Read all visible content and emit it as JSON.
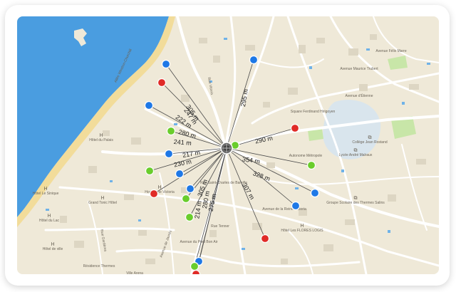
{
  "map": {
    "places": [
      {
        "label": "Allée Winston-Churchill",
        "icon": null
      },
      {
        "label": "Allée Winston-Churchill",
        "icon": null
      },
      {
        "label": "Avenue Maurice Trubert",
        "icon": null
      },
      {
        "label": "Avenue Félix Marre",
        "icon": null
      },
      {
        "label": "Avenue d'Étienne",
        "icon": null
      },
      {
        "label": "Hôtel du Palais",
        "icon": "H"
      },
      {
        "label": "Square Ferdinand Hirigoyen",
        "icon": null
      },
      {
        "label": "Collège Jean Rostand",
        "icon": "school"
      },
      {
        "label": "Lycée André Malraux",
        "icon": "school"
      },
      {
        "label": "Autonome Métropole",
        "icon": null
      },
      {
        "label": "Rue Vitoria",
        "icon": null
      },
      {
        "label": "Grand Tonic Hôtel",
        "icon": "H"
      },
      {
        "label": "Hostellerie Victoria",
        "icon": "H"
      },
      {
        "label": "Groupe Scolaire des Thermes Salins",
        "icon": "school"
      },
      {
        "label": "Hôtel du Lac",
        "icon": "H"
      },
      {
        "label": "Hôtel de ville",
        "icon": "H"
      },
      {
        "label": "Résidence Thermes",
        "icon": null
      },
      {
        "label": "Avenue du Pont Bon Air",
        "icon": null
      },
      {
        "label": "Rue Tenner",
        "icon": null
      },
      {
        "label": "Hôtel Les FLORES LOGIS",
        "icon": "H"
      },
      {
        "label": "Ville Arena",
        "icon": null
      },
      {
        "label": "Rue Saint-Charles de Bareille",
        "icon": null
      },
      {
        "label": "Avenue de la Reine Victoria",
        "icon": null
      },
      {
        "label": "Hôtel Le Sinique",
        "icon": "H"
      },
      {
        "label": "Rue Gardères",
        "icon": null
      },
      {
        "label": "Avenue de Jaurès",
        "icon": null
      }
    ],
    "distances": [
      "305 m",
      "222 m",
      "247 m",
      "280 m",
      "241 m",
      "217 m",
      "230 m",
      "295 m",
      "290 m",
      "354 m",
      "328 m",
      "307 m",
      "305 m",
      "280 m",
      "275 m",
      "214 m"
    ],
    "markers": [
      {
        "status": "available",
        "color": "#1e78e6"
      },
      {
        "status": "taken",
        "color": "#e02b27"
      },
      {
        "status": "available",
        "color": "#1e78e6"
      },
      {
        "status": "active",
        "color": "#6acd2c"
      },
      {
        "status": "available",
        "color": "#1e78e6"
      },
      {
        "status": "active",
        "color": "#6acd2c"
      },
      {
        "status": "taken",
        "color": "#e02b27"
      },
      {
        "status": "available",
        "color": "#1e78e6"
      },
      {
        "status": "available",
        "color": "#1e78e6"
      },
      {
        "status": "active",
        "color": "#6acd2c"
      },
      {
        "status": "active",
        "color": "#6acd2c"
      },
      {
        "status": "active",
        "color": "#6acd2c"
      },
      {
        "status": "taken",
        "color": "#e02b27"
      },
      {
        "status": "available",
        "color": "#1e78e6"
      },
      {
        "status": "active",
        "color": "#6acd2c"
      },
      {
        "status": "taken",
        "color": "#e02b27"
      },
      {
        "status": "available",
        "color": "#1e78e6"
      },
      {
        "status": "available",
        "color": "#1e78e6"
      },
      {
        "status": "available",
        "color": "#1e78e6"
      },
      {
        "status": "taken",
        "color": "#e02b27"
      },
      {
        "status": "active",
        "color": "#6acd2c"
      }
    ],
    "colors": {
      "sea": "#4a9de0",
      "beach": "#f2dc9a",
      "land": "#efe9d8",
      "road": "#ffffff",
      "park": "#c8e6a8",
      "blue": "#1e78e6",
      "red": "#e02b27",
      "green": "#6acd2c"
    },
    "center_icon": "hub-icon"
  }
}
